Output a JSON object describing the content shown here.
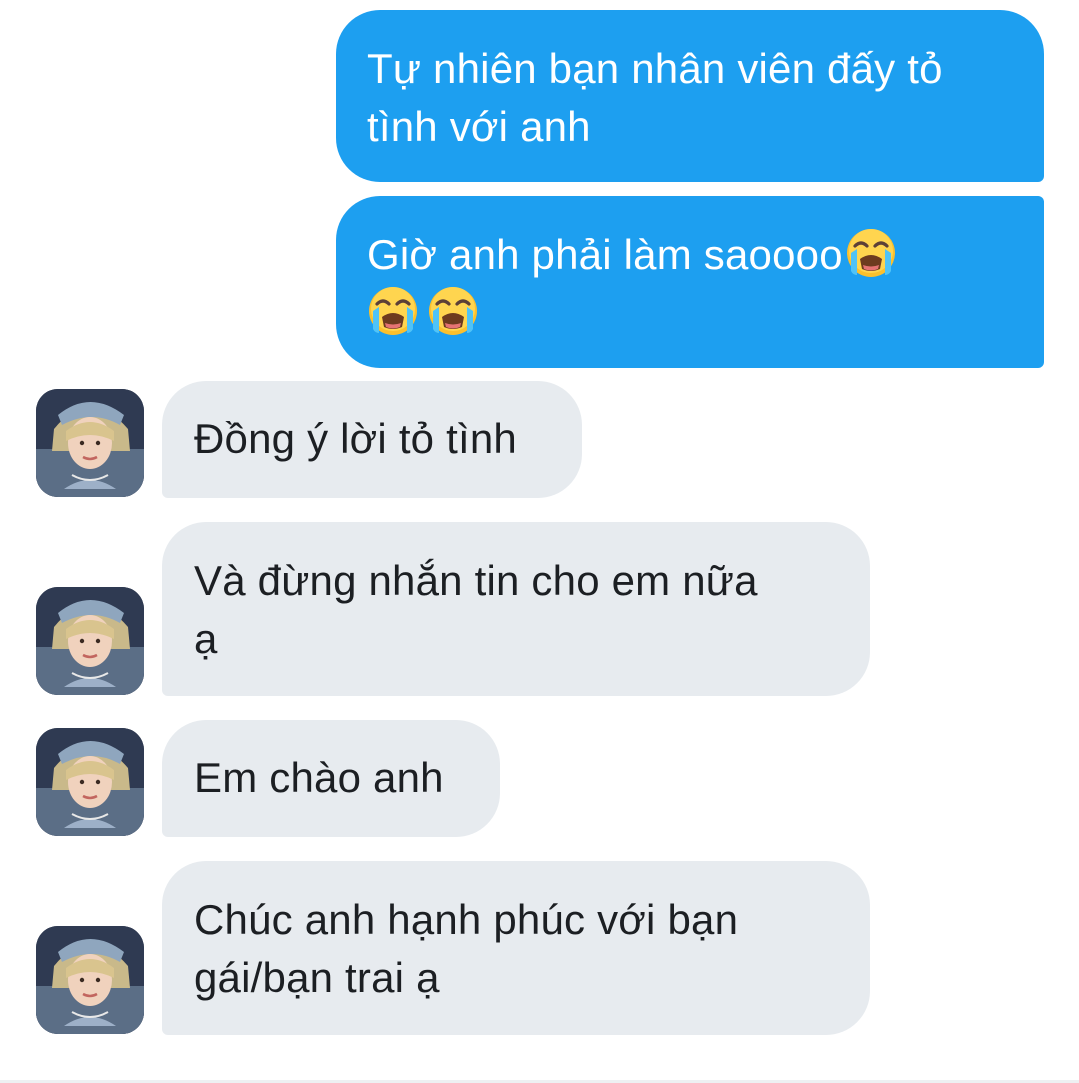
{
  "colors": {
    "outgoing_bubble": "#1d9ff0",
    "outgoing_text": "#ffffff",
    "incoming_bubble": "#e7ebef",
    "incoming_text": "#1c1f23",
    "background": "#ffffff"
  },
  "messages": [
    {
      "direction": "outgoing",
      "text": "Tự nhiên bạn nhân viên đấy tỏ\ntình với anh",
      "emojis": []
    },
    {
      "direction": "outgoing",
      "text": "Giờ anh phải làm saoooo",
      "emojis": [
        "loudly-crying-face-emoji",
        "loudly-crying-face-emoji",
        "loudly-crying-face-emoji"
      ]
    },
    {
      "direction": "incoming",
      "text": "Đồng ý lời tỏ tình",
      "avatar": "contact-avatar"
    },
    {
      "direction": "incoming",
      "text": "Và đừng nhắn tin cho em nữa\nạ",
      "avatar": "contact-avatar"
    },
    {
      "direction": "incoming",
      "text": "Em chào anh",
      "avatar": "contact-avatar"
    },
    {
      "direction": "incoming",
      "text": "Chúc anh hạnh phúc với bạn\ngái/bạn trai ạ",
      "avatar": "contact-avatar"
    }
  ]
}
